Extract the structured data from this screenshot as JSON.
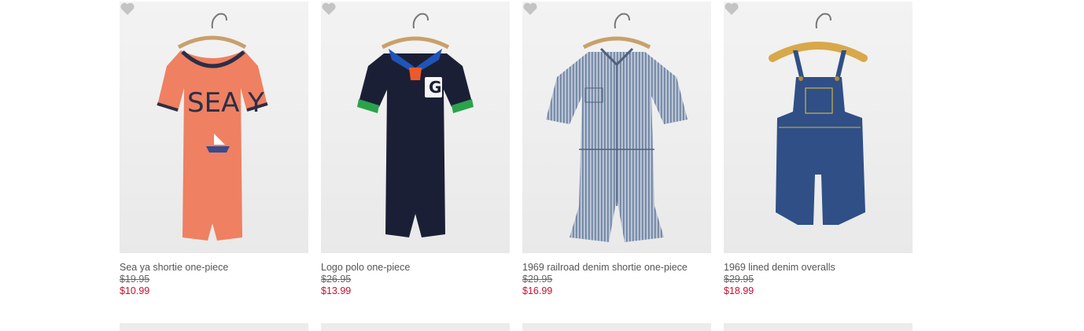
{
  "colors": {
    "sale_price": "#c8102e",
    "favorite_icon": "#c4c4c4"
  },
  "products": [
    {
      "name": "Sea ya shortie one-piece",
      "was_price": "$19.95",
      "price": "$10.99",
      "image_text": "SEA Y"
    },
    {
      "name": "Logo polo one-piece",
      "was_price": "$26.95",
      "price": "$13.99",
      "image_text": "G"
    },
    {
      "name": "1969 railroad denim shortie one-piece",
      "was_price": "$29.95",
      "price": "$16.99"
    },
    {
      "name": "1969 lined denim overalls",
      "was_price": "$29.95",
      "price": "$18.99"
    }
  ],
  "icons": {
    "favorite": "heart-icon",
    "hanger": "hanger-icon"
  }
}
